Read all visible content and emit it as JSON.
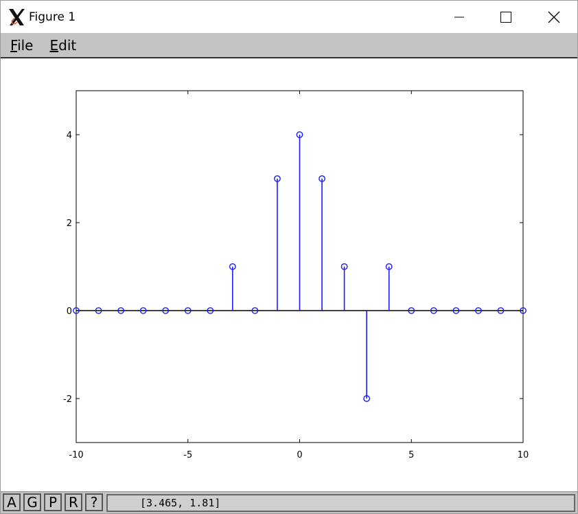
{
  "window": {
    "title": "Figure 1",
    "icon": "x11-icon"
  },
  "menu": {
    "items": [
      {
        "label": "File",
        "mnemonic": "F",
        "rest": "ile"
      },
      {
        "label": "Edit",
        "mnemonic": "E",
        "rest": "dit"
      }
    ]
  },
  "toolbar": {
    "buttons": [
      "A",
      "G",
      "P",
      "R",
      "?"
    ],
    "coordinates": "[3.465, 1.81]"
  },
  "colors": {
    "stem": "#1a1aff",
    "menubar": "#c4c4c4",
    "axis": "#000000"
  },
  "chart_data": {
    "type": "stem",
    "x": [
      -10,
      -9,
      -8,
      -7,
      -6,
      -5,
      -4,
      -3,
      -2,
      -1,
      0,
      1,
      2,
      3,
      4,
      5,
      6,
      7,
      8,
      9,
      10
    ],
    "y": [
      0,
      0,
      0,
      0,
      0,
      0,
      0,
      1,
      0,
      3,
      4,
      3,
      1,
      -2,
      1,
      0,
      0,
      0,
      0,
      0,
      0
    ],
    "xlim": [
      -10,
      10
    ],
    "ylim": [
      -3,
      5
    ],
    "xticks": [
      -10,
      -5,
      0,
      5,
      10
    ],
    "yticks": [
      -2,
      0,
      2,
      4
    ],
    "marker": "circle",
    "baseline": 0,
    "grid": false,
    "title": "",
    "xlabel": "",
    "ylabel": ""
  }
}
